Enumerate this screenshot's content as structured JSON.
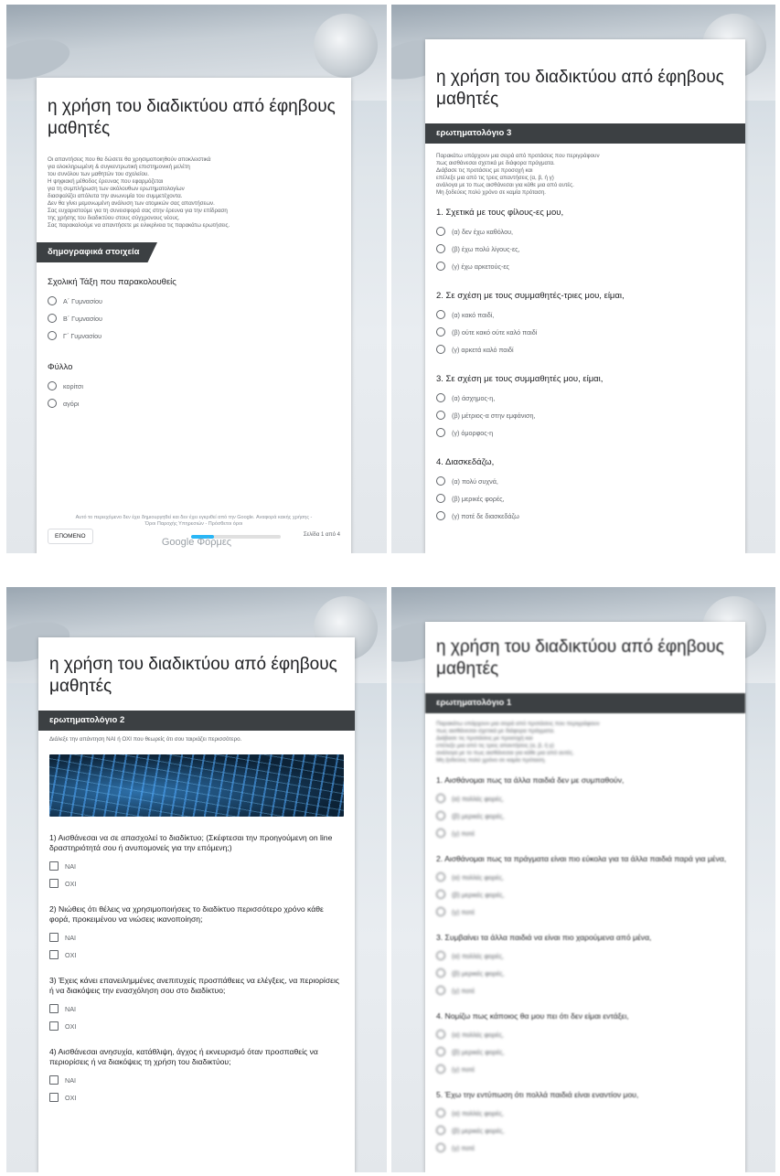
{
  "form_title": "η χρήση του διαδικτύου από έφηβους μαθητές",
  "screen1": {
    "description": [
      "Οι απαντήσεις που θα δώσετε θα χρησιμοποιηθούν αποκλειστικά",
      "για ολοκληρωμένη & συγκεντρωτική επιστημονική μελέτη",
      "του συνόλου των μαθητών του σχολείου.",
      "Η ψηφιακή μέθοδος έρευνας που εφαρμόζεται",
      "για τη συμπλήρωση των ακόλουθων ερωτηματολογίων",
      "διασφαλίζει απόλυτα την ανωνυμία του συμμετέχοντα.",
      "Δεν θα γίνει μεμονωμένη ανάλυση των ατομικών σας απαντήσεων.",
      "Σας ευχαριστούμε για τη συνεισφορά σας στην έρευνα για την επίδραση",
      "της χρήσης του διαδικτύου στους σύγχρονους νέους.",
      "Σας παρακαλούμε να απαντήσετε με ειλικρίνεια τις παρακάτω ερωτήσεις."
    ],
    "section_title": "δημογραφικά στοιχεία",
    "q1": {
      "label": "Σχολική Τάξη που παρακολουθείς",
      "options": [
        "Α΄ Γυμνασίου",
        "Β΄ Γυμνασίου",
        "Γ΄ Γυμνασίου"
      ]
    },
    "q2": {
      "label": "Φύλλο",
      "options": [
        "κορίτσι",
        "αγόρι"
      ]
    },
    "next_label": "ΕΠΟΜΕΝΟ",
    "progress": 0.25,
    "page_label": "Σελίδα 1 από 4",
    "footer_line1": "Αυτό το περιεχόμενο δεν έχει δημιουργηθεί και δεν έχει εγκριθεί από την Google. Αναφορά κακής χρήσης -",
    "footer_line2": "Όροι Παροχής Υπηρεσιών - Πρόσθετοι όροι",
    "brand": "Google Φόρμες"
  },
  "screen2": {
    "section_title": "ερωτηματολόγιο 3",
    "description": [
      "Παρακάτω υπάρχουν μια σειρά από προτάσεις που περιγράφουν",
      "πως αισθάνεσαι σχετικά με διάφορα πράγματα.",
      "Διάβασε τις προτάσεις με προσοχή και",
      "επέλεξε μια από τις τρεις απαντήσεις (α, β, ή γ)",
      "ανάλογα με το πως αισθάνεσαι για κάθε μια από αυτές.",
      "Μη ξοδεύεις πολύ χρόνο σε καμία πρόταση."
    ],
    "questions": [
      {
        "label": "1. Σχετικά με τους φίλους-ες μου,",
        "options": [
          "(α) δεν έχω καθόλου,",
          "(β) έχω πολύ λίγους-ες,",
          "(γ) έχω αρκετούς-ες"
        ]
      },
      {
        "label": "2. Σε σχέση με τους συμμαθητές-τριες μου, είμαι,",
        "options": [
          "(α) κακό παιδί,",
          "(β) ούτε κακό ούτε καλό παιδί",
          "(γ) αρκετά καλό παιδί"
        ]
      },
      {
        "label": "3. Σε σχέση με τους συμμαθητές μου, είμαι,",
        "options": [
          "(α) άσχημος-η,",
          "(β) μέτριος-α στην εμφάνιση,",
          "(γ) όμορφος-η"
        ]
      },
      {
        "label": "4. Διασκεδάζω,",
        "options": [
          "(α) πολύ συχνά,",
          "(β) μερικές φορές,",
          "(γ) ποτέ δε διασκεδάζω"
        ]
      }
    ]
  },
  "screen3": {
    "section_title": "ερωτηματολόγιο 2",
    "description": "Διάλεξε την απάντηση ΝΑΙ ή ΟΧΙ που θεωρείς ότι σου ταιριάζει περισσότερο.",
    "questions": [
      {
        "label": "1) Αισθάνεσαι να σε απασχολεί το διαδίκτυο; (Σκέφτεσαι την προηγούμενη on line δραστηριότητά σου ή ανυπομονείς για την επόμενη;)",
        "options": [
          "ΝΑΙ",
          "ΟΧΙ"
        ]
      },
      {
        "label": "2) Νιώθεις ότι θέλεις να χρησιμοποιήσεις το διαδίκτυο περισσότερο χρόνο κάθε φορά, προκειμένου να νιώσεις ικανοποίηση;",
        "options": [
          "ΝΑΙ",
          "ΟΧΙ"
        ]
      },
      {
        "label": "3) Έχεις κάνει επανειλημμένες ανεπιτυχείς προσπάθειες να ελέγξεις, να περιορίσεις ή να διακόψεις την ενασχόληση σου στο διαδίκτυο;",
        "options": [
          "ΝΑΙ",
          "ΟΧΙ"
        ]
      },
      {
        "label": "4) Αισθάνεσαι ανησυχία, κατάθλιψη, άγχος ή εκνευρισμό όταν προσπαθείς να περιορίσεις ή να διακόψεις τη χρήση του διαδικτύου;",
        "options": [
          "ΝΑΙ",
          "ΟΧΙ"
        ]
      }
    ]
  },
  "screen4": {
    "section_title": "ερωτηματολόγιο 1",
    "description": [
      "Παρακάτω υπάρχουν μια σειρά από προτάσεις που περιγράφουν",
      "πως αισθάνεσαι σχετικά με διάφορα πράγματα.",
      "Διάβασε τις προτάσεις με προσοχή και",
      "επέλεξε μια από τις τρεις απαντήσεις (α, β, ή γ)",
      "ανάλογα με το πως αισθάνεσαι για κάθε μια από αυτές.",
      "Μη ξοδεύεις πολύ χρόνο σε καμία πρόταση."
    ],
    "questions": [
      {
        "label": "1. Αισθάνομαι πως τα άλλα παιδιά δεν με συμπαθούν,",
        "options": [
          "(α) πολλές φορές,",
          "(β) μερικές φορές,",
          "(γ) ποτέ"
        ]
      },
      {
        "label": "2. Αισθάνομαι πως τα πράγματα είναι πιο εύκολα για τα άλλα παιδιά παρά για μένα,",
        "options": [
          "(α) πολλές φορές,",
          "(β) μερικές φορές,",
          "(γ) ποτέ"
        ]
      },
      {
        "label": "3. Συμβαίνει τα άλλα παιδιά να είναι πιο χαρούμενα από μένα,",
        "options": [
          "(α) πολλές φορές,",
          "(β) μερικές φορές,",
          "(γ) ποτέ"
        ]
      },
      {
        "label": "4. Νομίζω πως κάποιος θα μου πει ότι δεν είμαι εντάξει,",
        "options": [
          "(α) πολλές φορές,",
          "(β) μερικές φορές,",
          "(γ) ποτέ"
        ]
      },
      {
        "label": "5. Έχω την εντύπωση ότι πολλά παιδιά είναι εναντίον μου,",
        "options": [
          "(α) πολλές φορές,",
          "(β) μερικές φορές,",
          "(γ) ποτέ"
        ]
      }
    ]
  }
}
